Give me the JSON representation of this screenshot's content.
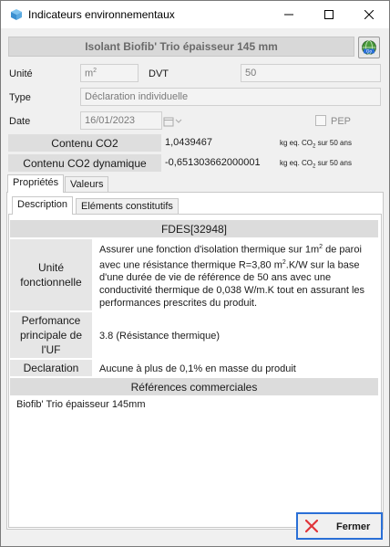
{
  "window": {
    "title": "Indicateurs environnementaux"
  },
  "product": {
    "name": "Isolant Biofib' Trio épaisseur 145 mm"
  },
  "fields": {
    "unite_label": "Unité",
    "unite_value": "m",
    "unite_exponent": "2",
    "dvt_label": "DVT",
    "dvt_value": "50",
    "type_label": "Type",
    "type_value": "Déclaration individuelle",
    "date_label": "Date",
    "date_value": "16/01/2023",
    "pep_label": "PEP"
  },
  "co2": {
    "rows": [
      {
        "label": "Contenu CO2",
        "value": "1,0439467",
        "unit_prefix": "kg eq. CO",
        "unit_sub": "2",
        "unit_suffix": " sur 50 ans"
      },
      {
        "label": "Contenu CO2 dynamique",
        "value": "-0,651303662000001",
        "unit_prefix": "kg eq. CO",
        "unit_sub": "2",
        "unit_suffix": " sur 50 ans"
      }
    ]
  },
  "tabs": {
    "outer": [
      "Propriétés",
      "Valeurs"
    ],
    "inner": [
      "Description",
      "Eléments constitutifs"
    ]
  },
  "description": {
    "fdes_title": "FDES[32948]",
    "uf_label": "Unité fonctionnelle",
    "uf_text_1": "Assurer une fonction d'isolation thermique sur 1m",
    "uf_text_sup1": "2",
    "uf_text_2": " de paroi avec une résistance thermique R=3,80 m",
    "uf_text_sup2": "2",
    "uf_text_3": ".K/W sur la base d'une durée de vie de référence de 50 ans avec une conductivité thermique de 0,038 W/m.K tout en assurant les performances prescrites du produit.",
    "perf_label": "Perfomance principale de l'UF",
    "perf_text": "3.8 (Résistance thermique)",
    "decl_label": "Declaration",
    "decl_text": "Aucune à plus de 0,1% en masse du produit",
    "refs_title": "Références commerciales",
    "refs": [
      "Biofib' Trio épaisseur 145mm"
    ]
  },
  "buttons": {
    "fermer": "Fermer"
  },
  "colors": {
    "accent": "#2a6fd6",
    "close_x": "#e0353a"
  }
}
